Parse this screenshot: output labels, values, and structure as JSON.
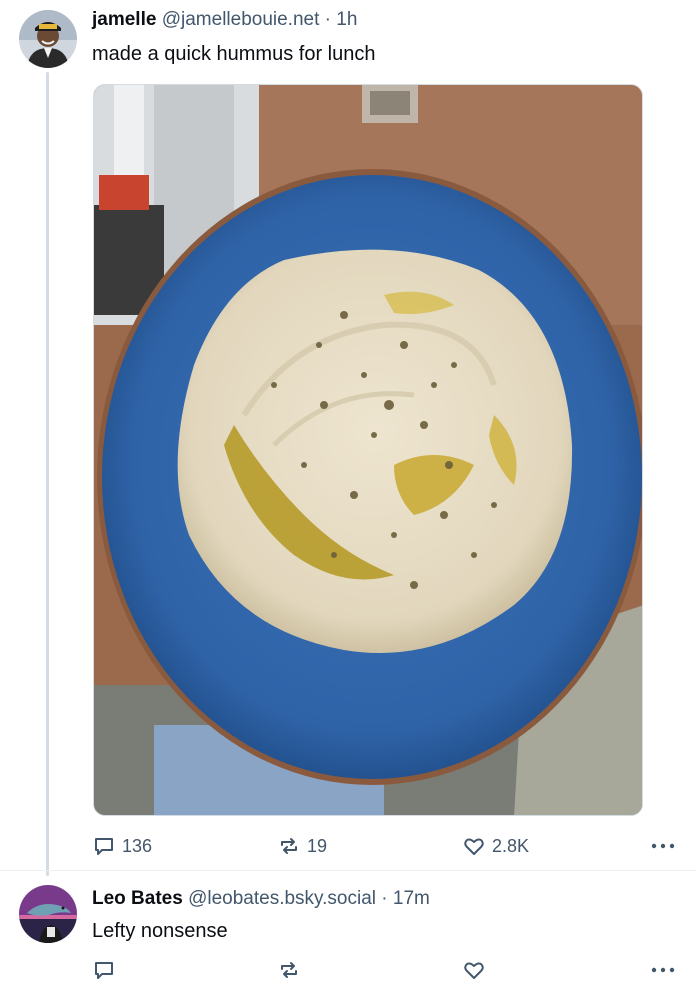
{
  "post1": {
    "display_name": "jamelle",
    "handle": "@jamellebouie.net",
    "separator": "·",
    "time": "1h",
    "text": "made a quick hummus for lunch",
    "image_icon": "photo-of-hummus-on-blue-plate",
    "stats": {
      "replies": "136",
      "reposts": "19",
      "likes": "2.8K"
    }
  },
  "post2": {
    "display_name": "Leo Bates",
    "handle": "@leobates.bsky.social",
    "separator": "·",
    "time": "17m",
    "text": "Lefty nonsense"
  },
  "icons": [
    "reply-icon",
    "repost-icon",
    "like-icon",
    "more-icon"
  ],
  "colors": {
    "thread_line": "#d4dbe2",
    "meta_text": "#42576c",
    "text": "#0b0f14"
  }
}
